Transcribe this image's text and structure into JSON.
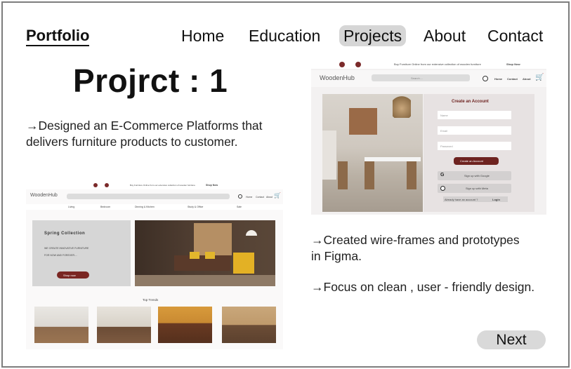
{
  "header": {
    "brand": "Portfolio",
    "nav": [
      {
        "label": "Home",
        "active": false
      },
      {
        "label": "Education",
        "active": false
      },
      {
        "label": "Projects",
        "active": true
      },
      {
        "label": "About",
        "active": false
      },
      {
        "label": "Contact",
        "active": false
      }
    ]
  },
  "project": {
    "title": "Projrct : 1",
    "description_1": "→Designed an E-Commerce Platforms that delivers furniture products to customer.",
    "description_2": "→Created wire-frames and prototypes in Figma.",
    "description_3": "→Focus on clean , user - friendly design."
  },
  "mock_signup": {
    "promo": "Buy Furniture Online from our extensive collection of wooden furniture",
    "shop_now": "Shop Now",
    "logo": "WoodenHub",
    "search_placeholder": "Search....",
    "nav": [
      "Home",
      "Contact",
      "About"
    ],
    "form_title": "Create an Account",
    "fields": [
      "Name",
      "Email",
      "Password"
    ],
    "cta": "Create an Account",
    "google": "Sign up with Google",
    "meta": "Sign up with Meta",
    "have_account": "Already have an account ?",
    "login": "Login"
  },
  "mock_home": {
    "promo": "Buy Furniture Online from our extensive collection of wooden furniture",
    "shop_now": "Shop Now",
    "logo": "WoodenHub",
    "nav": [
      "Home",
      "Contact",
      "About"
    ],
    "categories": [
      "Living",
      "Bedroom",
      "Dinning & Kitchen",
      "Study & Office",
      "Sale"
    ],
    "banner_title": "Spring Collection",
    "banner_line_1": "WE CREATE INNOVATIVE FURNITURE",
    "banner_line_2": "FOR NOW AND FOREVER....",
    "banner_cta": "Shop now",
    "section_title": "Top Trends"
  },
  "actions": {
    "next": "Next"
  },
  "colors": {
    "accent_maroon": "#7a2622",
    "active_nav_bg": "#d6d6d6",
    "next_bg": "#d9d9d9",
    "frame_border": "#7d7d7d"
  }
}
